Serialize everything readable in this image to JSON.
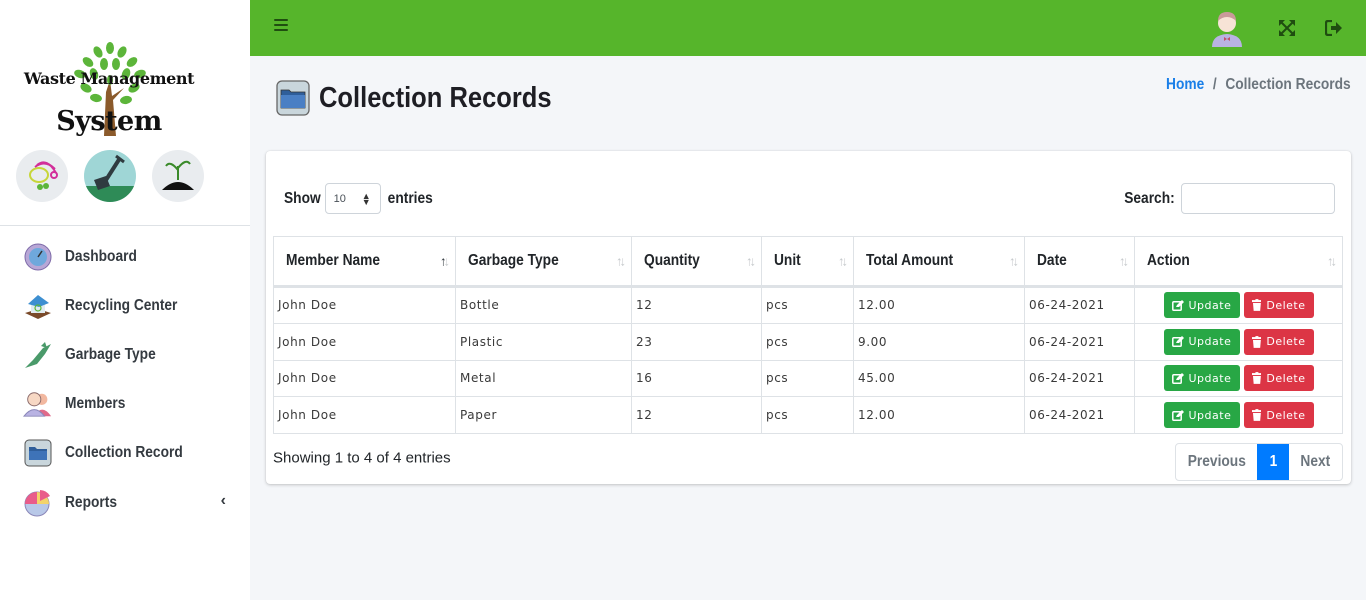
{
  "brand": {
    "line1": "Waste Management",
    "line2": "System",
    "circle_icons": [
      "recycle-bag-icon",
      "shovel-icon",
      "sprout-soil-icon"
    ]
  },
  "sidebar": {
    "items": [
      {
        "label": "Dashboard",
        "icon": "dashboard-gauge-icon"
      },
      {
        "label": "Recycling Center",
        "icon": "recycling-house-icon"
      },
      {
        "label": "Garbage Type",
        "icon": "garbage-bag-icon"
      },
      {
        "label": "Members",
        "icon": "members-icon"
      },
      {
        "label": "Collection Record",
        "icon": "folder-icon"
      },
      {
        "label": "Reports",
        "icon": "pie-chart-icon",
        "has_submenu": true
      }
    ]
  },
  "topbar": {
    "menu_icon": "hamburger-icon",
    "avatar_icon": "user-avatar-icon",
    "expand_icon": "fullscreen-icon",
    "logout_icon": "logout-icon",
    "color": "#56b52b"
  },
  "page": {
    "title": "Collection Records",
    "breadcrumb": {
      "home": "Home",
      "separator": "/",
      "current": "Collection Records"
    }
  },
  "table_controls": {
    "show_label": "Show",
    "entries_label": "entries",
    "page_length": "10",
    "search_label": "Search:",
    "search_value": ""
  },
  "table": {
    "columns": [
      "Member Name",
      "Garbage Type",
      "Quantity",
      "Unit",
      "Total Amount",
      "Date",
      "Action"
    ],
    "rows": [
      {
        "member": "John Doe",
        "type": "Bottle",
        "quantity": "12",
        "unit": "pcs",
        "total": "12.00",
        "date": "06-24-2021"
      },
      {
        "member": "John Doe",
        "type": "Plastic",
        "quantity": "23",
        "unit": "pcs",
        "total": "9.00",
        "date": "06-24-2021"
      },
      {
        "member": "John Doe",
        "type": "Metal",
        "quantity": "16",
        "unit": "pcs",
        "total": "45.00",
        "date": "06-24-2021"
      },
      {
        "member": "John Doe",
        "type": "Paper",
        "quantity": "12",
        "unit": "pcs",
        "total": "12.00",
        "date": "06-24-2021"
      }
    ],
    "update_label": "Update",
    "delete_label": "Delete",
    "update_color": "#28a745",
    "delete_color": "#dc3545"
  },
  "footer": {
    "info": "Showing 1 to 4 of 4 entries",
    "previous": "Previous",
    "current_page": "1",
    "next": "Next",
    "active_color": "#007bff"
  }
}
